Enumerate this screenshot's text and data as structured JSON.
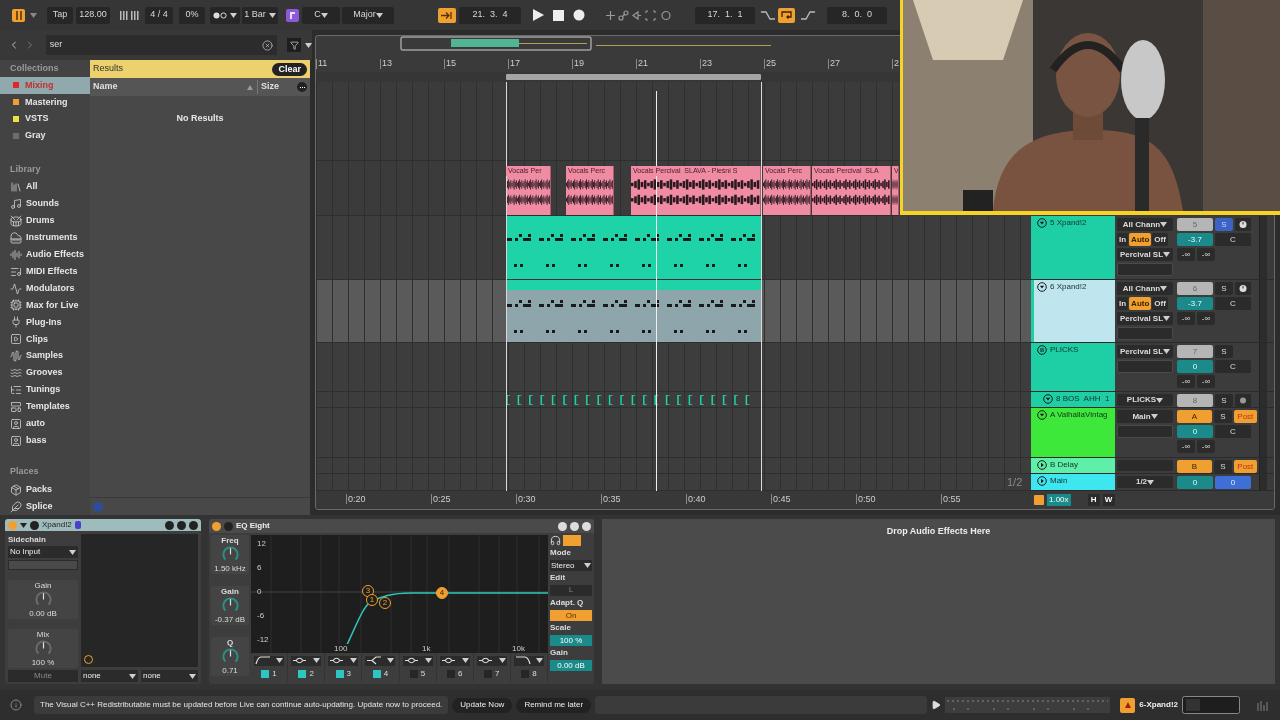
{
  "transport": {
    "tap": "Tap",
    "tempo": "128.00",
    "signature": "4 / 4",
    "groove": "0%",
    "quantize": "1 Bar",
    "key": "C",
    "scale": "Major",
    "position": "21.  3.  4",
    "loop_start": "17.  1.  1",
    "loop_length": "8.  0.  0",
    "loop_on": true
  },
  "browser": {
    "search": "ser",
    "collections_heading": "Collections",
    "collections": [
      {
        "label": "Mixing",
        "color": "#e0262c",
        "selected": true
      },
      {
        "label": "Mastering",
        "color": "#f0a030",
        "selected": false
      },
      {
        "label": "VSTS",
        "color": "#f0e040",
        "selected": false
      },
      {
        "label": "Gray",
        "color": "#6e6e6e",
        "selected": false
      }
    ],
    "library_heading": "Library",
    "library": [
      {
        "label": "All",
        "kind": "all"
      },
      {
        "label": "Sounds",
        "kind": "sounds"
      },
      {
        "label": "Drums",
        "kind": "drums"
      },
      {
        "label": "Instruments",
        "kind": "instruments"
      },
      {
        "label": "Audio Effects",
        "kind": "audio_effects"
      },
      {
        "label": "MIDI Effects",
        "kind": "midi_effects"
      },
      {
        "label": "Modulators",
        "kind": "modulators"
      },
      {
        "label": "Max for Live",
        "kind": "max"
      },
      {
        "label": "Plug-Ins",
        "kind": "plugins"
      },
      {
        "label": "Clips",
        "kind": "clips"
      },
      {
        "label": "Samples",
        "kind": "samples"
      },
      {
        "label": "Grooves",
        "kind": "grooves"
      },
      {
        "label": "Tunings",
        "kind": "tunings"
      },
      {
        "label": "Templates",
        "kind": "templates"
      },
      {
        "label": "auto",
        "kind": "folder"
      },
      {
        "label": "bass",
        "kind": "folder"
      }
    ],
    "places_heading": "Places",
    "places": [
      {
        "label": "Packs",
        "kind": "packs"
      },
      {
        "label": "Splice",
        "kind": "splice"
      }
    ],
    "results": {
      "title": "Results",
      "clear": "Clear",
      "columns": [
        "Name",
        "Size"
      ],
      "empty": "No Results"
    }
  },
  "timeline": {
    "bars": [
      "11",
      "13",
      "15",
      "17",
      "19",
      "21",
      "23",
      "25",
      "27",
      "2"
    ],
    "times": [
      "0:20",
      "0:25",
      "0:30",
      "0:35",
      "0:40",
      "0:45",
      "0:50",
      "0:55"
    ],
    "vocal_clips": [
      "Vocals Per",
      "Vocals Perc",
      "Vocals Percival  SLAVA - Pieśni S",
      "Vocals Perc",
      "Vocals Percival  SLA",
      "V"
    ],
    "page": "1/2"
  },
  "tracks": [
    {
      "name": "5 Xpand!2",
      "kind": "midi",
      "color": "#1ecfa6",
      "expanded": true,
      "selected": false,
      "input": "All Chann",
      "monitor": [
        {
          "label": "In",
          "selected": false
        },
        {
          "label": "Auto",
          "selected": true
        },
        {
          "label": "Off",
          "selected": false
        }
      ],
      "output": "Percival SL",
      "number": "5",
      "solo_label": "S",
      "solo": true,
      "volume": "-3.7",
      "pan": "C",
      "peaks": [
        "-∞",
        "-∞"
      ]
    },
    {
      "name": "6 Xpand!2",
      "kind": "midi",
      "color": "#1ecfa6",
      "expanded": true,
      "selected": true,
      "input": "All Chann",
      "monitor": [
        {
          "label": "In",
          "selected": false
        },
        {
          "label": "Auto",
          "selected": true
        },
        {
          "label": "Off",
          "selected": false
        }
      ],
      "output": "Percival SL",
      "number": "6",
      "solo_label": "S",
      "solo": false,
      "volume": "-3.7",
      "pan": "C",
      "peaks": [
        "-∞",
        "-∞"
      ]
    },
    {
      "name": "PLICKS",
      "kind": "group",
      "color": "#1ecfa6",
      "expanded": true,
      "selected": false,
      "output": "Percival SL",
      "number": "7",
      "solo_label": "S",
      "solo": false,
      "volume": "0",
      "pan": "C",
      "peaks": [
        "-∞",
        "-∞"
      ],
      "children": [
        {
          "name": "8 BOS  AHH  1",
          "kind": "audio",
          "color": "#1ecfa6",
          "expanded": true,
          "selected": false,
          "output": "PLICKS",
          "number": "8",
          "solo_label": "S",
          "solo": false
        }
      ]
    },
    {
      "name": "A ValhallaVintag",
      "kind": "return",
      "color": "#3ee83a",
      "expanded": true,
      "selected": false,
      "output": "Main",
      "number": "A",
      "solo_label": "S",
      "solo": false,
      "post": "Post",
      "volume": "0",
      "pan": "C",
      "peaks": [
        "-∞",
        "-∞"
      ]
    },
    {
      "name": "B Delay",
      "kind": "return",
      "color": "#5ef0a8",
      "expanded": false,
      "selected": false,
      "number": "B",
      "solo_label": "S",
      "solo": false,
      "post": "Post"
    },
    {
      "name": "Main",
      "kind": "main",
      "color": "#3ee6f0",
      "expanded": false,
      "selected": false,
      "output": "1/2",
      "volume": "0",
      "pan": "0"
    }
  ],
  "mixer_footer": {
    "zoom": "1.00x",
    "buttons": [
      "H",
      "W"
    ]
  },
  "xpand": {
    "title": "Xpand!2",
    "on": true,
    "sidechain_label": "Sidechain",
    "sidechain": "No Input",
    "knobs": [
      {
        "label": "Gain",
        "value": "0.00 dB"
      },
      {
        "label": "Mix",
        "value": "100 %"
      }
    ],
    "mute": "Mute",
    "selectors": [
      "none",
      "none"
    ]
  },
  "eq": {
    "title": "EQ Eight",
    "on": true,
    "knobs": [
      {
        "label": "Freq",
        "value": "1.50 kHz"
      },
      {
        "label": "Gain",
        "value": "-0.37 dB"
      },
      {
        "label": "Q",
        "value": "0.71"
      }
    ],
    "y_labels": [
      "12",
      "6",
      "0",
      "-6",
      "-12"
    ],
    "x_labels": [
      "100",
      "1k",
      "10k"
    ],
    "points": [
      "3",
      "1",
      "2",
      "4"
    ],
    "bands": [
      {
        "label": "1",
        "kind": "lowcut",
        "on": true
      },
      {
        "label": "2",
        "kind": "bell",
        "on": true
      },
      {
        "label": "3",
        "kind": "bell",
        "on": true
      },
      {
        "label": "4",
        "kind": "shelf",
        "on": true
      },
      {
        "label": "5",
        "kind": "bell",
        "on": false
      },
      {
        "label": "6",
        "kind": "bell",
        "on": false
      },
      {
        "label": "7",
        "kind": "bell",
        "on": false
      },
      {
        "label": "8",
        "kind": "highcut",
        "on": false
      }
    ],
    "mode_label": "Mode",
    "mode": "Stereo",
    "edit_label": "Edit",
    "edit": "L",
    "adapt_label": "Adapt. Q",
    "adapt": "On",
    "scale_label": "Scale",
    "scale": "100 %",
    "gain_label": "Gain",
    "gain": "0.00 dB"
  },
  "drop_hint": "Drop Audio Effects Here",
  "status": {
    "message": "The Visual C++ Redistributable must be updated before Live can continue auto-updating. Update now to proceed.",
    "update": "Update Now",
    "remind": "Remind me later",
    "track": "6-Xpand!2"
  }
}
